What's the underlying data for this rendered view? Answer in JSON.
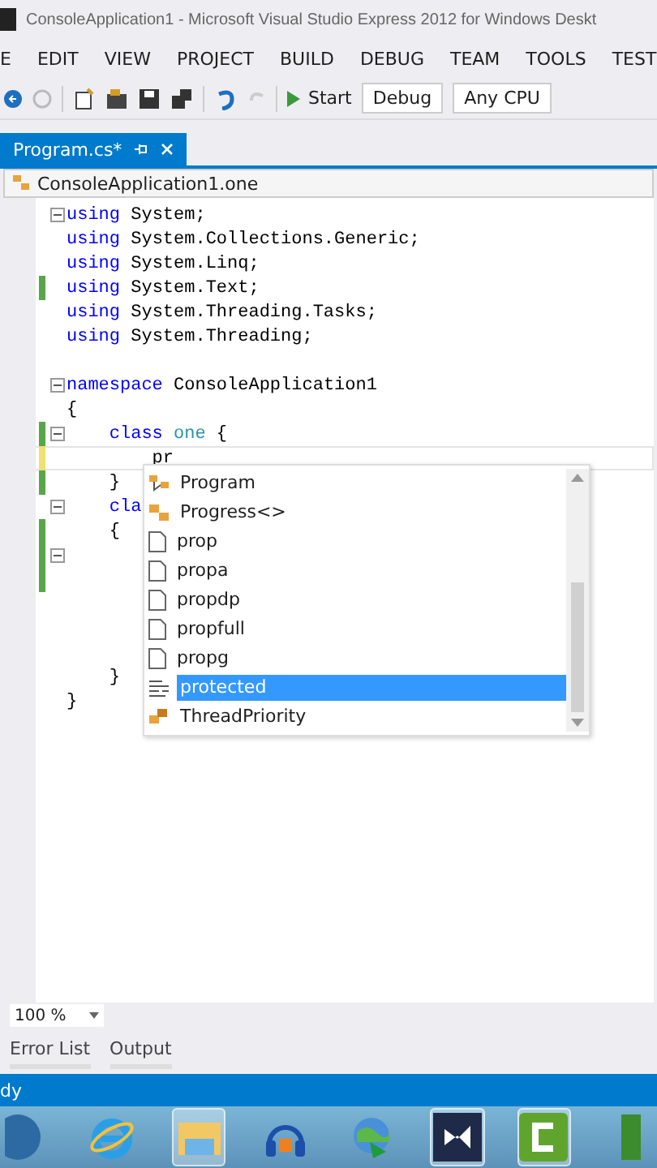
{
  "window": {
    "title": "ConsoleApplication1 - Microsoft Visual Studio Express 2012 for Windows Deskt"
  },
  "menu": [
    "E",
    "EDIT",
    "VIEW",
    "PROJECT",
    "BUILD",
    "DEBUG",
    "TEAM",
    "TOOLS",
    "TEST"
  ],
  "toolbar": {
    "start": "Start",
    "configuration": "Debug",
    "platform": "Any CPU"
  },
  "tab": {
    "label": "Program.cs*",
    "selected": true
  },
  "navigation": {
    "scope": "ConsoleApplication1.one"
  },
  "code_lines": [
    {
      "fold": true,
      "changed": false,
      "segments": [
        {
          "kind": "keyword",
          "text": "using"
        },
        {
          "kind": "plain",
          "text": " System;"
        }
      ]
    },
    {
      "fold": false,
      "changed": false,
      "segments": [
        {
          "kind": "keyword",
          "text": "using"
        },
        {
          "kind": "plain",
          "text": " System.Collections.Generic;"
        }
      ]
    },
    {
      "fold": false,
      "changed": false,
      "segments": [
        {
          "kind": "keyword",
          "text": "using"
        },
        {
          "kind": "plain",
          "text": " System.Linq;"
        }
      ]
    },
    {
      "fold": false,
      "changed": true,
      "saved": true,
      "segments": [
        {
          "kind": "keyword",
          "text": "using"
        },
        {
          "kind": "plain",
          "text": " System.Text;"
        }
      ]
    },
    {
      "fold": false,
      "changed": false,
      "segments": [
        {
          "kind": "keyword",
          "text": "using"
        },
        {
          "kind": "plain",
          "text": " System.Threading.Tasks;"
        }
      ]
    },
    {
      "fold": false,
      "changed": false,
      "segments": [
        {
          "kind": "keyword",
          "text": "using"
        },
        {
          "kind": "plain",
          "text": " System.Threading;"
        }
      ]
    },
    {
      "fold": false,
      "changed": false
    },
    {
      "fold": true,
      "changed": false,
      "segments": [
        {
          "kind": "keyword",
          "text": "namespace"
        },
        {
          "kind": "plain",
          "text": " ConsoleApplication1"
        }
      ]
    },
    {
      "fold": false,
      "changed": false,
      "segments": [
        {
          "kind": "plain",
          "text": "{"
        }
      ]
    },
    {
      "fold": true,
      "changed": true,
      "saved": true,
      "segments": [
        {
          "kind": "keyword",
          "text": "    class"
        },
        {
          "kind": "type",
          "text": " one"
        },
        {
          "kind": "plain",
          "text": " {"
        }
      ]
    },
    {
      "fold": false,
      "changed": true,
      "saved": false,
      "current": true,
      "segments": [
        {
          "kind": "plain",
          "text": "        pr"
        }
      ]
    },
    {
      "fold": false,
      "changed": true,
      "saved": true,
      "segments": [
        {
          "kind": "plain",
          "text": "    }"
        }
      ]
    },
    {
      "fold": true,
      "changed": false,
      "segments": [
        {
          "kind": "keyword",
          "text": "    cla"
        }
      ]
    },
    {
      "fold": false,
      "changed": true,
      "saved": true,
      "segments": [
        {
          "kind": "plain",
          "text": "    {"
        }
      ]
    },
    {
      "fold": true,
      "changed": true,
      "saved": true
    },
    {
      "fold": false,
      "changed": true,
      "saved": true
    },
    {
      "fold": false,
      "changed": false
    },
    {
      "fold": false,
      "changed": false
    },
    {
      "fold": false,
      "changed": false
    },
    {
      "fold": false,
      "changed": false,
      "segments": [
        {
          "kind": "plain",
          "text": "    }"
        }
      ]
    },
    {
      "fold": false,
      "changed": false,
      "segments": [
        {
          "kind": "plain",
          "text": "}"
        }
      ]
    }
  ],
  "completion": [
    {
      "kind": "class",
      "label": "Program",
      "selected": false
    },
    {
      "kind": "generic",
      "label": "Progress<>",
      "selected": false
    },
    {
      "kind": "snippet",
      "label": "prop",
      "selected": false
    },
    {
      "kind": "snippet",
      "label": "propa",
      "selected": false
    },
    {
      "kind": "snippet",
      "label": "propdp",
      "selected": false
    },
    {
      "kind": "snippet",
      "label": "propfull",
      "selected": false
    },
    {
      "kind": "snippet",
      "label": "propg",
      "selected": false
    },
    {
      "kind": "keyword",
      "label": "protected",
      "selected": true
    },
    {
      "kind": "enum",
      "label": "ThreadPriority",
      "selected": false
    }
  ],
  "zoom": "100 %",
  "bottom_tabs": [
    "Error List",
    "Output"
  ],
  "status_bar": "dy",
  "taskbar": [
    {
      "kind": "start",
      "open": false
    },
    {
      "kind": "ie",
      "open": false
    },
    {
      "kind": "explorer",
      "open": true
    },
    {
      "kind": "audio",
      "open": false
    },
    {
      "kind": "globe",
      "open": false
    },
    {
      "kind": "vs",
      "open": true
    },
    {
      "kind": "camtasia",
      "open": true
    },
    {
      "kind": "green",
      "open": false
    }
  ]
}
